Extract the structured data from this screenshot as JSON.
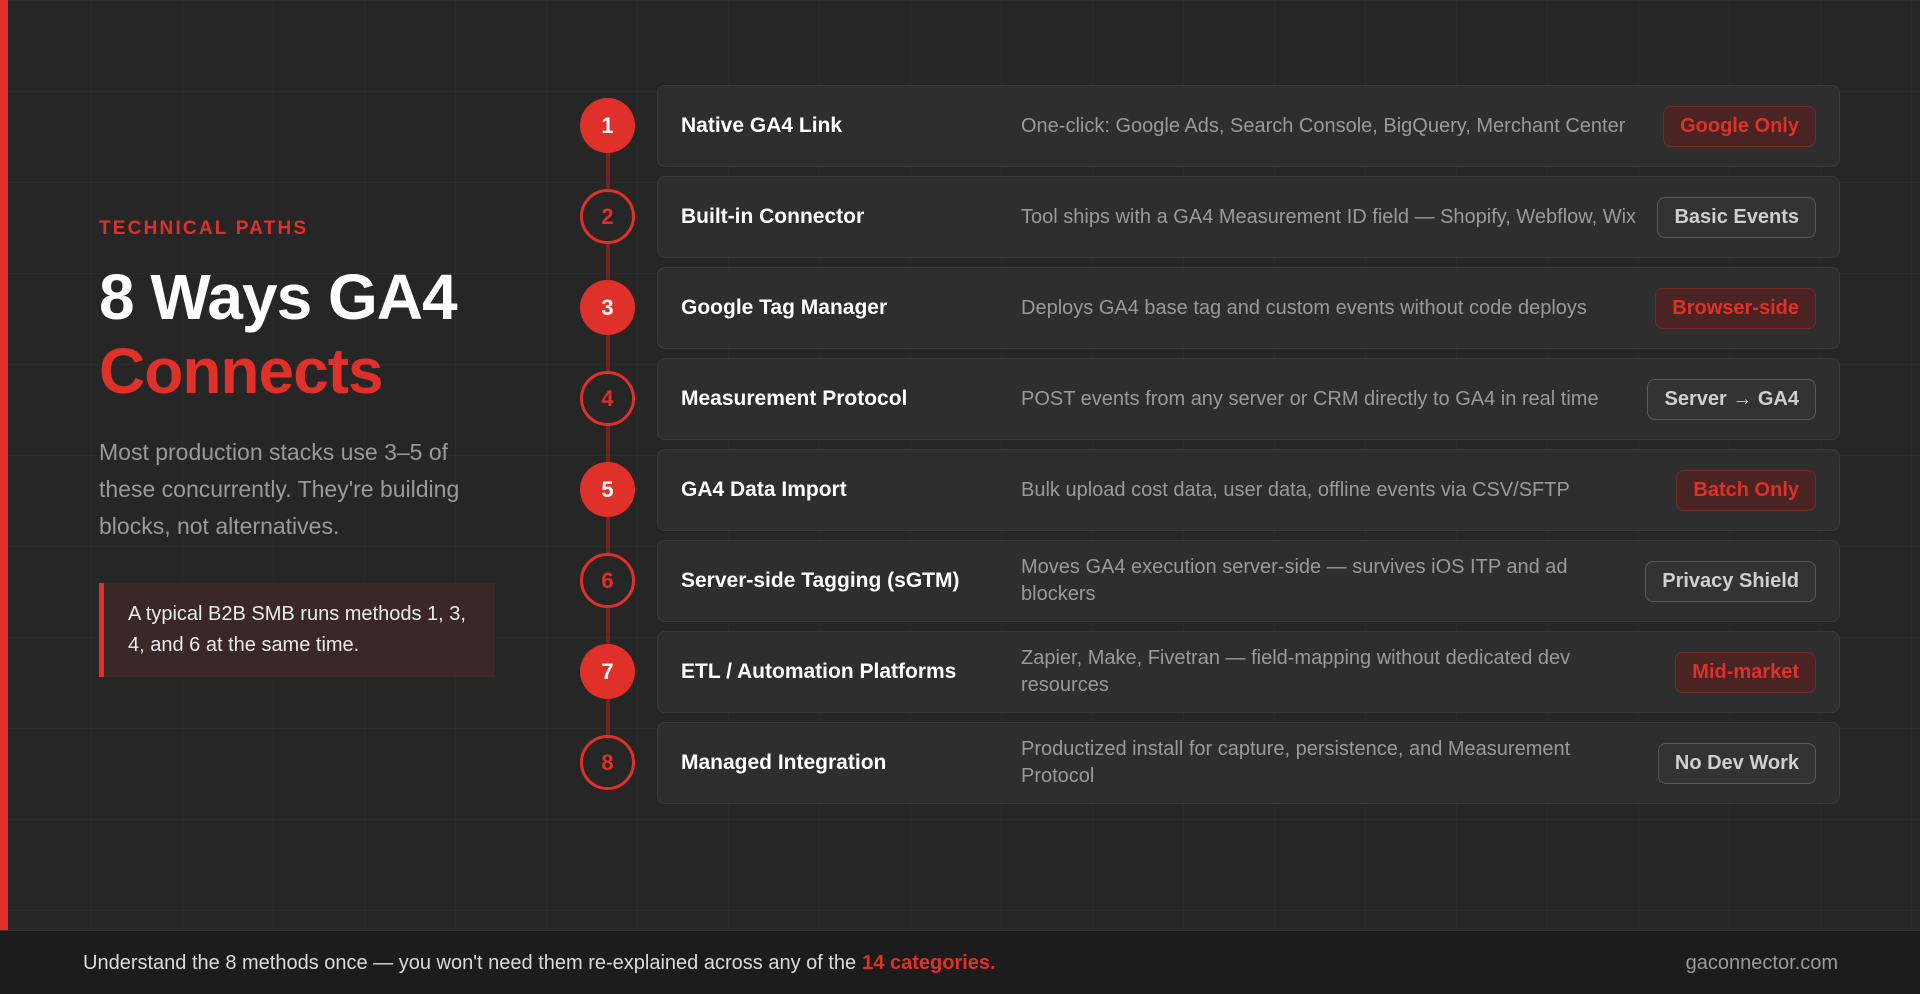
{
  "header": {
    "eyebrow": "TECHNICAL PATHS",
    "title_line1": "8 Ways GA4",
    "title_line2": "Connects",
    "description": "Most production stacks use 3–5 of these concurrently. They're building blocks, not alternatives.",
    "callout": "A typical B2B SMB runs methods 1, 3, 4, and 6 at the same time."
  },
  "methods": [
    {
      "number": "1",
      "name": "Native GA4 Link",
      "description": "One-click: Google Ads, Search Console, BigQuery, Merchant Center",
      "badge": "Google Only",
      "badge_style": "red",
      "marker": "filled"
    },
    {
      "number": "2",
      "name": "Built-in Connector",
      "description": "Tool ships with a GA4 Measurement ID field — Shopify, Webflow, Wix",
      "badge": "Basic Events",
      "badge_style": "gray",
      "marker": "outline"
    },
    {
      "number": "3",
      "name": "Google Tag Manager",
      "description": "Deploys GA4 base tag and custom events without code deploys",
      "badge": "Browser-side",
      "badge_style": "red",
      "marker": "filled"
    },
    {
      "number": "4",
      "name": "Measurement Protocol",
      "description": "POST events from any server or CRM directly to GA4 in real time",
      "badge": "Server → GA4",
      "badge_style": "gray",
      "marker": "outline"
    },
    {
      "number": "5",
      "name": "GA4 Data Import",
      "description": "Bulk upload cost data, user data, offline events via CSV/SFTP",
      "badge": "Batch Only",
      "badge_style": "red",
      "marker": "filled"
    },
    {
      "number": "6",
      "name": "Server-side Tagging (sGTM)",
      "description": "Moves GA4 execution server-side — survives iOS ITP and ad blockers",
      "badge": "Privacy Shield",
      "badge_style": "gray",
      "marker": "outline"
    },
    {
      "number": "7",
      "name": "ETL / Automation Platforms",
      "description": "Zapier, Make, Fivetran — field-mapping without dedicated dev resources",
      "badge": "Mid-market",
      "badge_style": "red",
      "marker": "filled"
    },
    {
      "number": "8",
      "name": "Managed Integration",
      "description": "Productized install for capture, persistence, and Measurement Protocol",
      "badge": "No Dev Work",
      "badge_style": "gray",
      "marker": "outline"
    }
  ],
  "footer": {
    "text": "Understand the 8 methods once — you won't need them re-explained across any of the",
    "highlight": "14 categories.",
    "domain": "gaconnector.com"
  },
  "colors": {
    "accent": "#e0302a",
    "background": "#262626",
    "row_background": "#2e2e2e"
  }
}
